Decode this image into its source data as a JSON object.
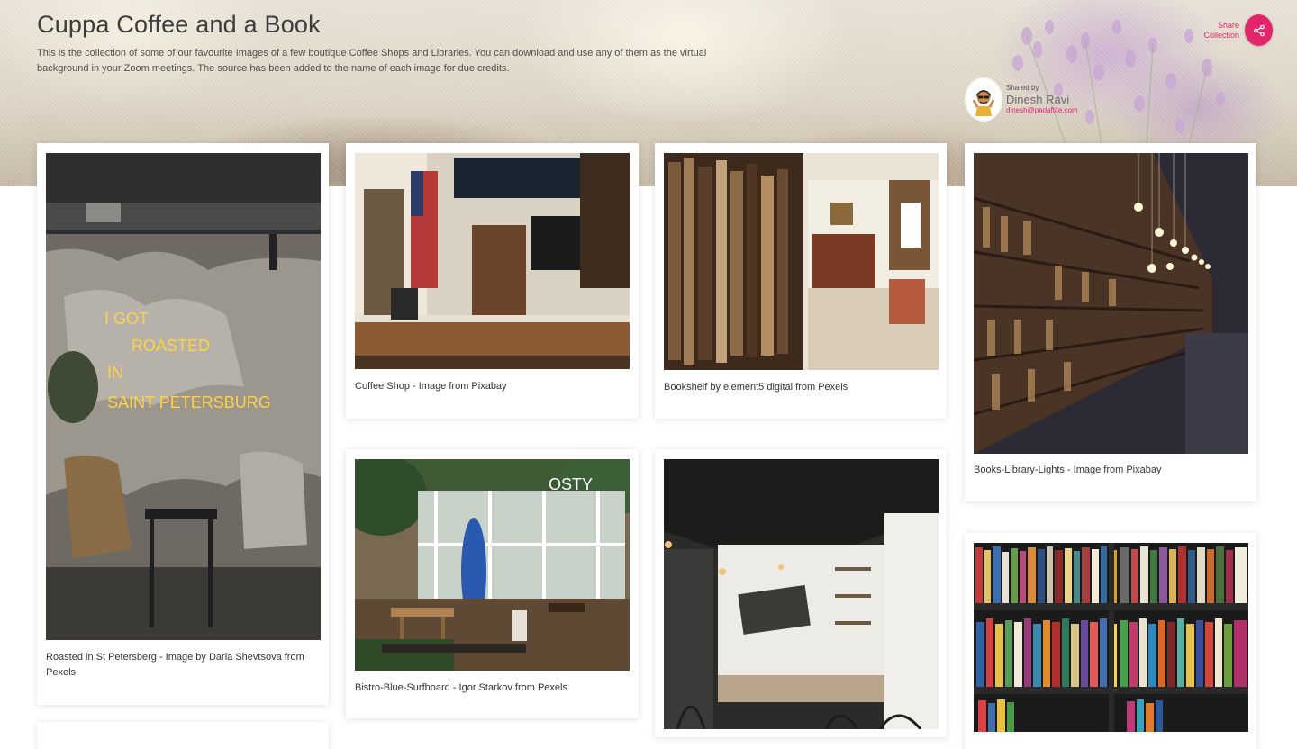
{
  "collection": {
    "title": "Cuppa Coffee and a Book",
    "description": "This is the collection of some of our favourite Images of a few boutique Coffee Shops and Libraries. You can download and use any of them as the virtual background in your Zoom meetings. The source has been added to the name of each image for due credits."
  },
  "share": {
    "label_line1": "Share",
    "label_line2": "Collection",
    "icon": "share-icon"
  },
  "sharer": {
    "label": "Shared by",
    "name": "Dinesh Ravi",
    "email": "dinesh@padaftite.com"
  },
  "colors": {
    "accent": "#e3256b",
    "caption_text": "#333333",
    "title_text": "#3d3d3d"
  },
  "images": [
    {
      "caption": "Roasted in St Petersberg - Image by Daria Shevtsova from Pexels",
      "neon_lines": [
        "I   GOT",
        "ROASTED",
        "IN",
        "SAINT PETERSBURG"
      ]
    },
    {
      "caption": "Coffee Shop - Image from Pixabay"
    },
    {
      "caption": "Bookshelf by element5 digital from Pexels"
    },
    {
      "caption": "Books-Library-Lights - Image from Pixabay"
    },
    {
      "caption": "Bistro-Blue-Surfboard - Igor Starkov from Pexels",
      "sign_text": "OSTY"
    },
    {
      "caption": ""
    },
    {
      "caption": ""
    }
  ]
}
